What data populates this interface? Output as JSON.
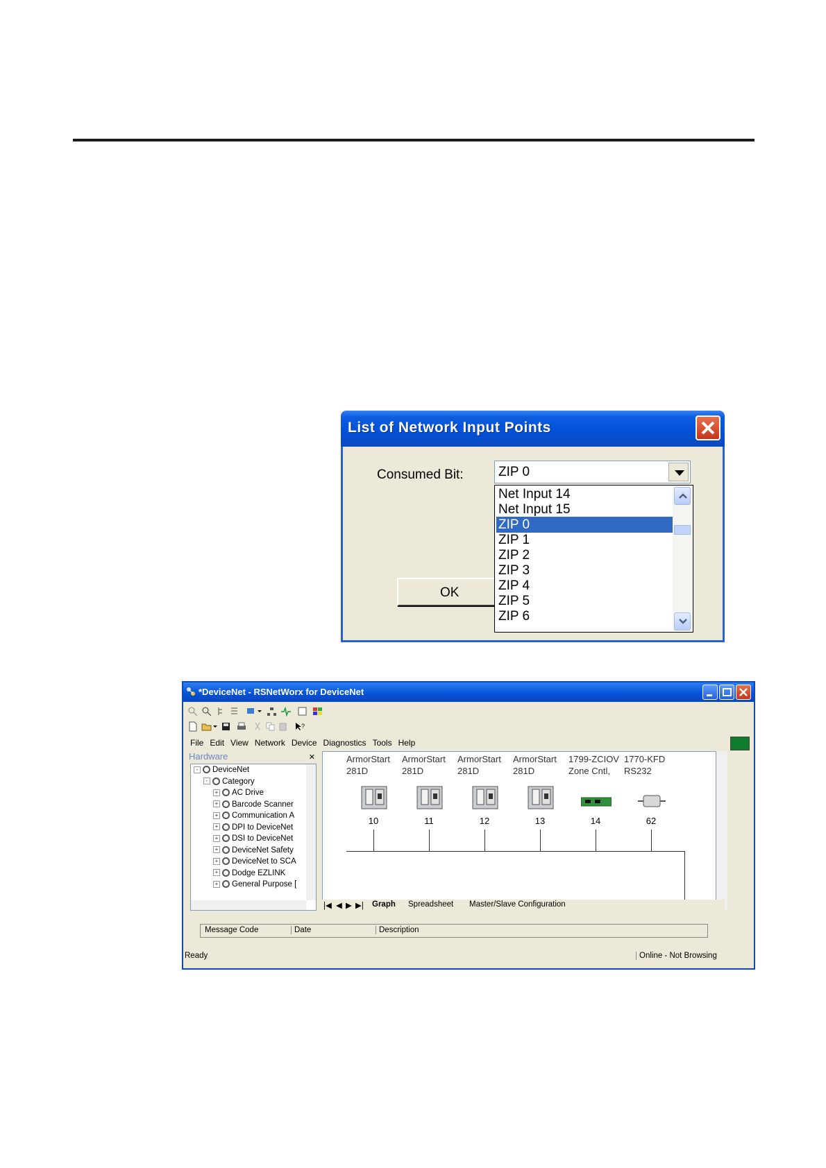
{
  "dialog": {
    "title": "List of Network Input Points",
    "consumed_bit_label": "Consumed Bit:",
    "selected_value": "ZIP 0",
    "ok_label": "OK",
    "options": [
      "Net Input 14",
      "Net Input 15",
      "ZIP 0",
      "ZIP 1",
      "ZIP 2",
      "ZIP 3",
      "ZIP 4",
      "ZIP 5",
      "ZIP 6"
    ],
    "selected_index": 2
  },
  "window": {
    "title": "*DeviceNet - RSNetWorx for DeviceNet",
    "menu": [
      "File",
      "Edit",
      "View",
      "Network",
      "Device",
      "Diagnostics",
      "Tools",
      "Help"
    ],
    "hardware_header": "Hardware",
    "tree": [
      {
        "label": "DeviceNet",
        "level": 0,
        "toggle": "-"
      },
      {
        "label": "Category",
        "level": 1,
        "toggle": "-"
      },
      {
        "label": "AC Drive",
        "level": 2,
        "toggle": "+"
      },
      {
        "label": "Barcode Scanner",
        "level": 2,
        "toggle": "+"
      },
      {
        "label": "Communication A",
        "level": 2,
        "toggle": "+"
      },
      {
        "label": "DPI to DeviceNet",
        "level": 2,
        "toggle": "+"
      },
      {
        "label": "DSI to DeviceNet",
        "level": 2,
        "toggle": "+"
      },
      {
        "label": "DeviceNet Safety",
        "level": 2,
        "toggle": "+"
      },
      {
        "label": "DeviceNet to SCA",
        "level": 2,
        "toggle": "+"
      },
      {
        "label": "Dodge EZLINK",
        "level": 2,
        "toggle": "+"
      },
      {
        "label": "General Purpose [",
        "level": 2,
        "toggle": "+"
      }
    ],
    "devices": [
      {
        "name1": "ArmorStart",
        "name2": "281D",
        "addr": "10",
        "kind": "armor"
      },
      {
        "name1": "ArmorStart",
        "name2": "281D",
        "addr": "11",
        "kind": "armor"
      },
      {
        "name1": "ArmorStart",
        "name2": "281D",
        "addr": "12",
        "kind": "armor"
      },
      {
        "name1": "ArmorStart",
        "name2": "281D",
        "addr": "13",
        "kind": "armor"
      },
      {
        "name1": "1799-ZCIOV",
        "name2": "Zone Cntl,",
        "addr": "14",
        "kind": "board"
      },
      {
        "name1": "1770-KFD",
        "name2": "RS232",
        "addr": "62",
        "kind": "kfd"
      }
    ],
    "tabs": [
      "Graph",
      "Spreadsheet",
      "Master/Slave Configuration"
    ],
    "msg_columns": [
      "Message Code",
      "Date",
      "Description"
    ],
    "status_left": "Ready",
    "status_right": "Online - Not Browsing"
  }
}
